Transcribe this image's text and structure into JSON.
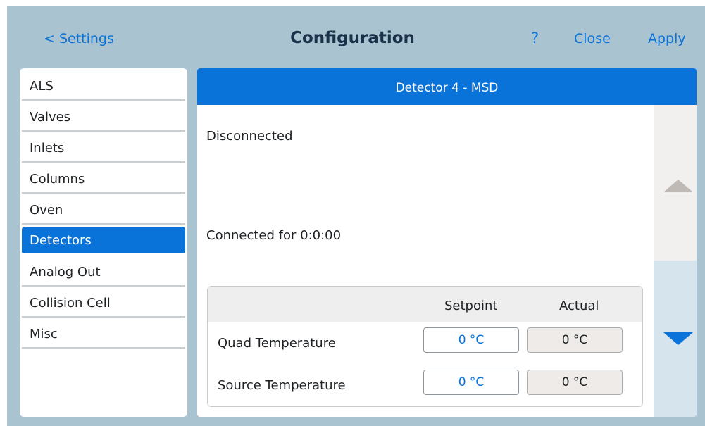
{
  "header": {
    "back_label": "< Settings",
    "title": "Configuration",
    "help_label": "?",
    "close_label": "Close",
    "apply_label": "Apply"
  },
  "sidebar": {
    "items": [
      {
        "label": "ALS"
      },
      {
        "label": "Valves"
      },
      {
        "label": "Inlets"
      },
      {
        "label": "Columns"
      },
      {
        "label": "Oven"
      },
      {
        "label": "Detectors",
        "selected": true
      },
      {
        "label": "Analog Out"
      },
      {
        "label": "Collision Cell"
      },
      {
        "label": "Misc"
      }
    ]
  },
  "panel": {
    "title": "Detector 4 - MSD",
    "status_line1": "Disconnected",
    "status_line2": "Connected for 0:0:00",
    "table": {
      "col_setpoint": "Setpoint",
      "col_actual": "Actual",
      "rows": [
        {
          "label": "Quad Temperature",
          "setpoint": "0 °C",
          "actual": "0 °C"
        },
        {
          "label": "Source Temperature",
          "setpoint": "0 °C",
          "actual": "0 °C"
        }
      ]
    }
  },
  "colors": {
    "accent": "#0a73d9",
    "background": "#a9c3d1",
    "title": "#1b3149"
  },
  "icons": {
    "scroll_up": "triangle-up-icon",
    "scroll_down": "triangle-down-icon"
  }
}
